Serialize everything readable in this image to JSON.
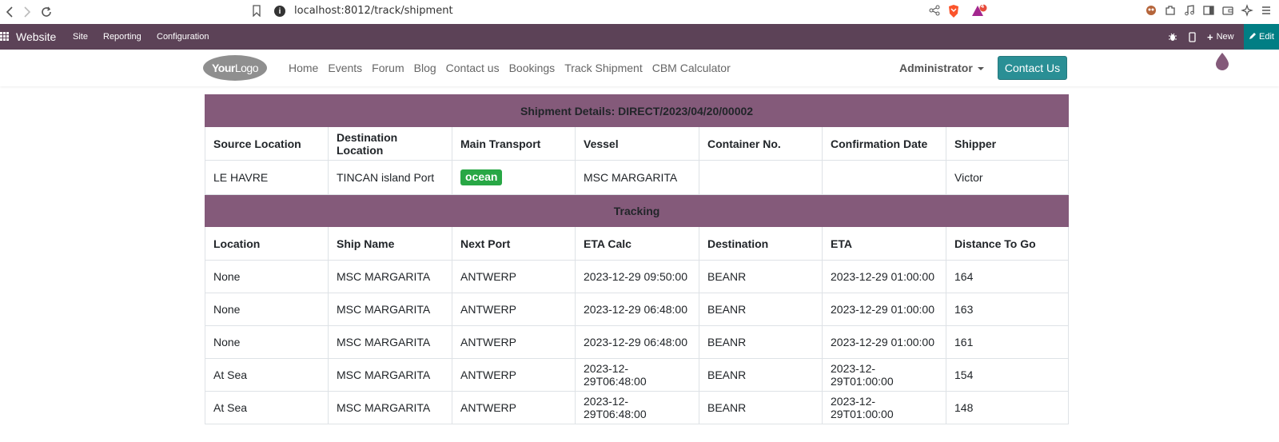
{
  "browser": {
    "url": "localhost:8012/track/shipment",
    "alert_count": "4"
  },
  "odoo_bar": {
    "brand": "Website",
    "menu": [
      "Site",
      "Reporting",
      "Configuration"
    ],
    "new_label": "New",
    "edit_label": "Edit"
  },
  "site": {
    "logo_bold": "Your",
    "logo_light": "Logo",
    "nav": [
      "Home",
      "Events",
      "Forum",
      "Blog",
      "Contact us",
      "Bookings",
      "Track Shipment",
      "CBM Calculator"
    ],
    "user": "Administrator",
    "contact_button": "Contact Us"
  },
  "shipment": {
    "title": "Shipment Details: DIRECT/2023/04/20/00002",
    "headers": [
      "Source Location",
      "Destination Location",
      "Main Transport",
      "Vessel",
      "Container No.",
      "Confirmation Date",
      "Shipper"
    ],
    "row": {
      "source": "LE HAVRE",
      "destination": "TINCAN island Port",
      "transport": "ocean",
      "vessel": "MSC MARGARITA",
      "container": "",
      "confirmation_date": "",
      "shipper": "Victor"
    }
  },
  "tracking": {
    "title": "Tracking",
    "headers": [
      "Location",
      "Ship Name",
      "Next Port",
      "ETA Calc",
      "Destination",
      "ETA",
      "Distance To Go"
    ],
    "rows": [
      [
        "None",
        "MSC MARGARITA",
        "ANTWERP",
        "2023-12-29 09:50:00",
        "BEANR",
        "2023-12-29 01:00:00",
        "164"
      ],
      [
        "None",
        "MSC MARGARITA",
        "ANTWERP",
        "2023-12-29 06:48:00",
        "BEANR",
        "2023-12-29 01:00:00",
        "163"
      ],
      [
        "None",
        "MSC MARGARITA",
        "ANTWERP",
        "2023-12-29 06:48:00",
        "BEANR",
        "2023-12-29 01:00:00",
        "161"
      ],
      [
        "At Sea",
        "MSC MARGARITA",
        "ANTWERP",
        "2023-12-29T06:48:00",
        "BEANR",
        "2023-12-29T01:00:00",
        "154"
      ],
      [
        "At Sea",
        "MSC MARGARITA",
        "ANTWERP",
        "2023-12-29T06:48:00",
        "BEANR",
        "2023-12-29T01:00:00",
        "148"
      ]
    ]
  },
  "colors": {
    "odoo_bar": "#5c4257",
    "section_header": "#845a7a",
    "edit_teal": "#017e84",
    "contact_teal": "#2a8f95",
    "ocean_badge": "#28a745"
  }
}
